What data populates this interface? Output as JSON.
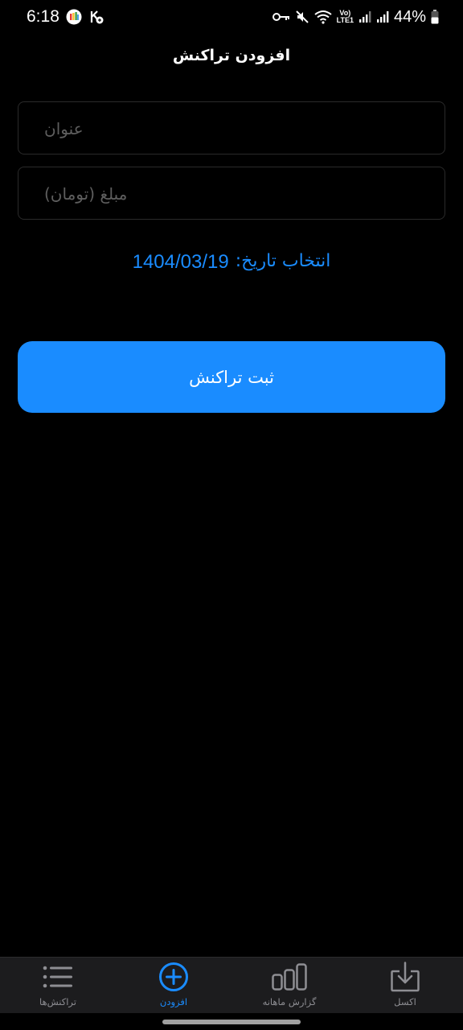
{
  "status_bar": {
    "time": "6:18",
    "battery_percent": "44%",
    "network_label_top": "Vo)",
    "network_label_bottom": "LTE1"
  },
  "page": {
    "title": "افزودن تراکنش"
  },
  "form": {
    "title_placeholder": "عنوان",
    "amount_placeholder": "مبلغ (تومان)",
    "date_label": "انتخاب تاریخ:",
    "date_value": "1404/03/19",
    "submit_label": "ثبت تراکنش"
  },
  "bottom_nav": {
    "items": [
      {
        "label": "تراکنش‌ها",
        "icon": "list-icon",
        "active": false
      },
      {
        "label": "افزودن",
        "icon": "plus-circle-icon",
        "active": true
      },
      {
        "label": "گزارش ماهانه",
        "icon": "bar-chart-icon",
        "active": false
      },
      {
        "label": "اکسل",
        "icon": "download-icon",
        "active": false
      }
    ]
  },
  "colors": {
    "accent": "#1a8cff",
    "background": "#000000",
    "nav_background": "#1c1c1e",
    "placeholder": "#5e5e5e",
    "inactive": "#8e8e93"
  }
}
